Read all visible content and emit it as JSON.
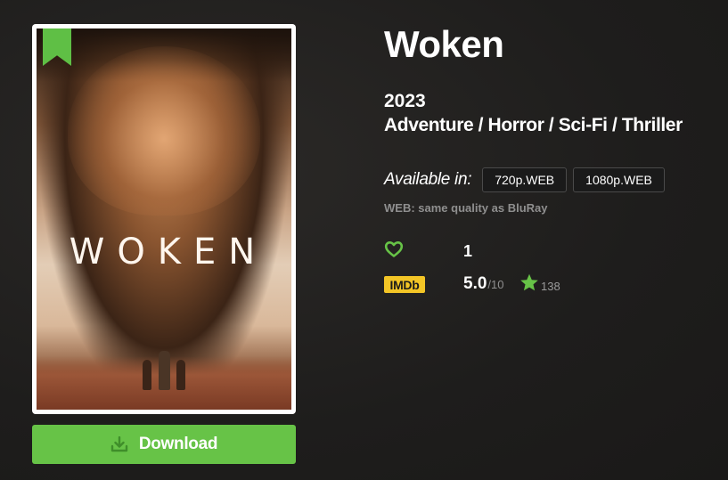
{
  "movie": {
    "title": "Woken",
    "year": "2023",
    "genres": "Adventure / Horror / Sci-Fi / Thriller",
    "poster": {
      "title_text": "WOKEN",
      "bookmark_color": "#5fbf45"
    }
  },
  "download": {
    "label": "Download",
    "icon": "download-icon",
    "color": "#67c347"
  },
  "availability": {
    "label": "Available in:",
    "qualities": [
      "720p.WEB",
      "1080p.WEB"
    ],
    "note": "WEB: same quality as BluRay"
  },
  "likes": {
    "icon": "heart-icon",
    "count": "1"
  },
  "imdb": {
    "badge": "IMDb",
    "rating": "5.0",
    "max": "/10",
    "votes": "138",
    "star_icon": "star-icon"
  },
  "colors": {
    "accent_green": "#67c347",
    "imdb_yellow": "#f3c526",
    "background": "#1f1e1d"
  }
}
